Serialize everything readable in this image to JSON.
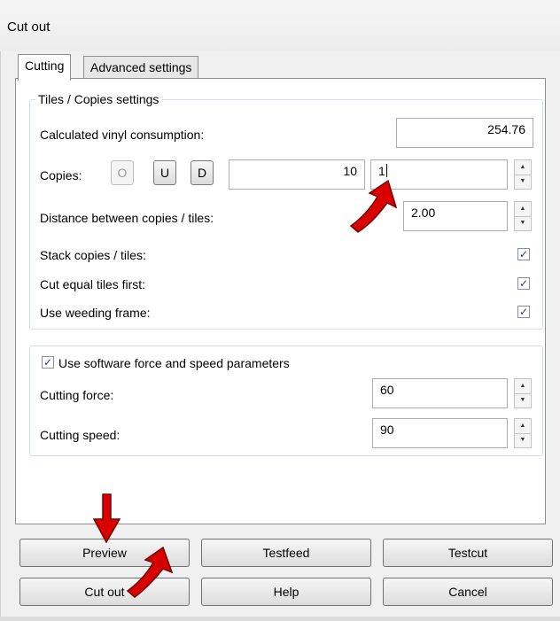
{
  "window": {
    "title": "Cut out"
  },
  "tabs": [
    {
      "label": "Cutting",
      "active": true
    },
    {
      "label": "Advanced settings",
      "active": false
    }
  ],
  "tiles_group": {
    "caption": "Tiles / Copies settings",
    "vinyl_consumption": {
      "label": "Calculated vinyl consumption:",
      "value": "254.76"
    },
    "copies": {
      "label": "Copies:",
      "buttons": [
        "O",
        "U",
        "D"
      ],
      "count_value": "10",
      "input_value": "1"
    },
    "distance": {
      "label": "Distance between copies / tiles:",
      "value": "2.00"
    },
    "stack_copies": {
      "label": "Stack copies / tiles:",
      "checked": true
    },
    "cut_equal_tiles": {
      "label": "Cut equal tiles first:",
      "checked": true
    },
    "weeding_frame": {
      "label": "Use weeding frame:",
      "checked": true
    }
  },
  "force_group": {
    "use_software": {
      "label": "Use software force and speed parameters",
      "checked": true
    },
    "cutting_force": {
      "label": "Cutting force:",
      "value": "60"
    },
    "cutting_speed": {
      "label": "Cutting speed:",
      "value": "90"
    }
  },
  "buttons": {
    "preview": "Preview",
    "testfeed": "Testfeed",
    "testcut": "Testcut",
    "cut_out": "Cut out",
    "help": "Help",
    "cancel": "Cancel"
  },
  "check_glyph": "✓",
  "annotation_color": "#d90000"
}
